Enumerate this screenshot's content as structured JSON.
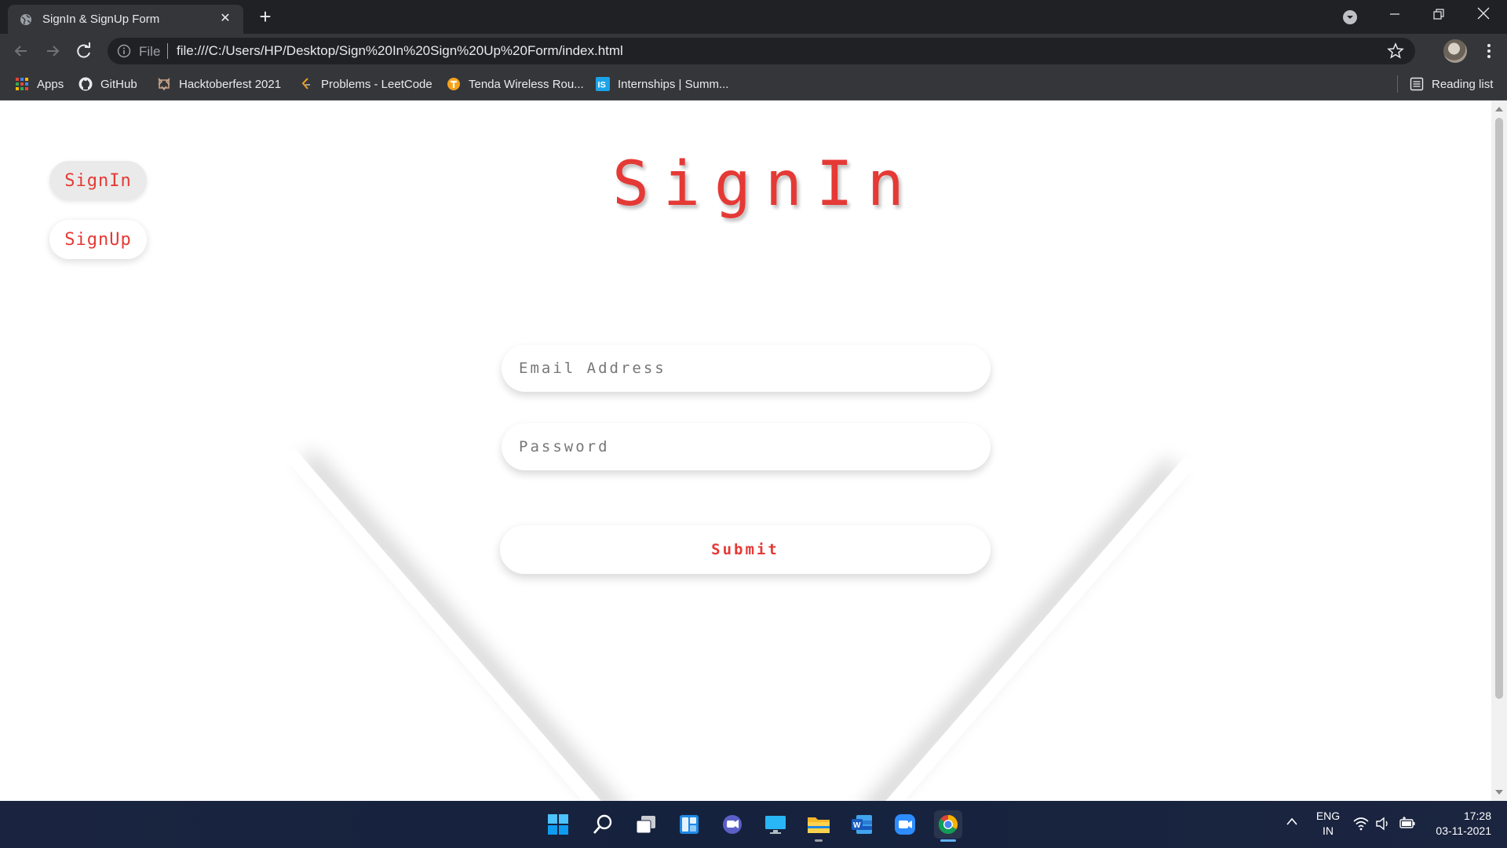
{
  "browser": {
    "tab_title": "SignIn & SignUp Form",
    "url_scheme": "File",
    "url": "file:///C:/Users/HP/Desktop/Sign%20In%20Sign%20Up%20Form/index.html"
  },
  "bookmarks": {
    "items": [
      {
        "label": "Apps",
        "icon": "apps-grid-icon"
      },
      {
        "label": "GitHub",
        "icon": "github-icon"
      },
      {
        "label": "Hacktoberfest 2021",
        "icon": "hacktoberfest-icon"
      },
      {
        "label": "Problems - LeetCode",
        "icon": "leetcode-icon"
      },
      {
        "label": "Tenda Wireless Rou...",
        "icon": "tenda-icon"
      },
      {
        "label": "Internships | Summ...",
        "icon": "internshala-icon"
      }
    ],
    "reading_list": "Reading list"
  },
  "page": {
    "nav": {
      "signin_label": "SignIn",
      "signup_label": "SignUp"
    },
    "heading": "SignIn",
    "form": {
      "email_placeholder": "Email Address",
      "password_placeholder": "Password",
      "submit_label": "Submit"
    },
    "accent_color": "#e53935"
  },
  "taskbar": {
    "apps": [
      "start-icon",
      "search-icon",
      "task-view-icon",
      "widgets-icon",
      "chat-icon",
      "desktop-icon",
      "file-explorer-icon",
      "word-icon",
      "zoom-icon",
      "chrome-icon"
    ],
    "language": "ENG",
    "region": "IN",
    "time": "17:28",
    "date": "03-11-2021"
  }
}
